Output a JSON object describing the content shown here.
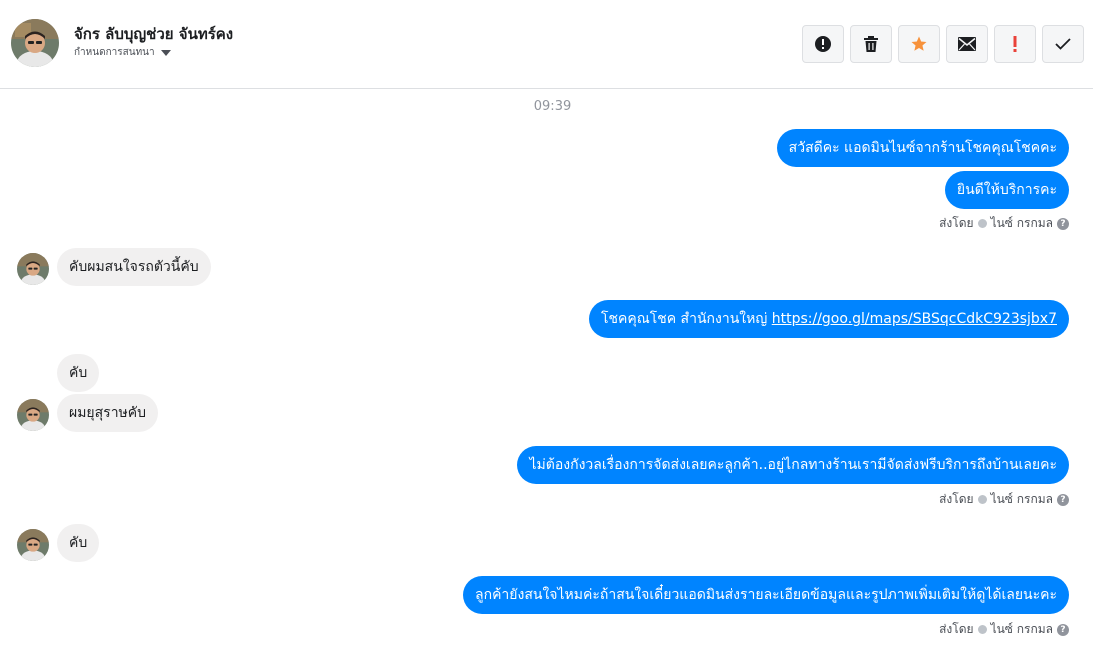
{
  "header": {
    "contact_name": "จักร ลับบุญช่วย จันทร์คง",
    "label_dropdown": "กำหนดการสนทนา",
    "toolbar": [
      {
        "name": "report-icon",
        "label": "!"
      },
      {
        "name": "trash-icon",
        "label": ""
      },
      {
        "name": "star-icon",
        "label": "★"
      },
      {
        "name": "envelope-icon",
        "label": ""
      },
      {
        "name": "important-icon",
        "label": "!"
      },
      {
        "name": "check-icon",
        "label": "✓"
      }
    ]
  },
  "conversation": {
    "timestamp": "09:39",
    "messages": [
      {
        "direction": "out",
        "text": "สวัสดีคะ แอดมินไนซ์จากร้านโชคคุณโชคคะ"
      },
      {
        "direction": "out",
        "text": "ยินดีให้บริการคะ"
      },
      {
        "direction": "in",
        "text": "คับผมสนใจรถตัวนี้คับ"
      },
      {
        "direction": "out",
        "text_prefix": "โชคคุณโชค สำนักงานใหญ่ ",
        "link": "https://goo.gl/maps/SBSqcCdkC923sjbx7"
      },
      {
        "direction": "in",
        "text": "คับ"
      },
      {
        "direction": "in",
        "text": "ผมยุสุราษคับ"
      },
      {
        "direction": "out",
        "text": "ไม่ต้องกังวลเรื่องการจัดส่งเลยคะลูกค้า..อยู่ไกลทางร้านเรามีจัดส่งฟรีบริการถึงบ้านเลยคะ"
      },
      {
        "direction": "in",
        "text": "คับ"
      },
      {
        "direction": "out",
        "text": "ลูกค้ายังสนใจไหมค่ะถ้าสนใจเดี๋ยวแอดมินส่งรายละเอียดข้อมูลและรูปภาพเพิ่มเติมให้ดูได้เลยนะคะ"
      }
    ],
    "sent_by_label": "ส่งโดย",
    "sent_by_name": "ไนซ์ กรกมล",
    "help_label": "?"
  },
  "colors": {
    "outgoing_bubble": "#0084ff",
    "incoming_bubble": "#f1f0f0",
    "star": "#f7923b",
    "important": "#e9423a"
  }
}
